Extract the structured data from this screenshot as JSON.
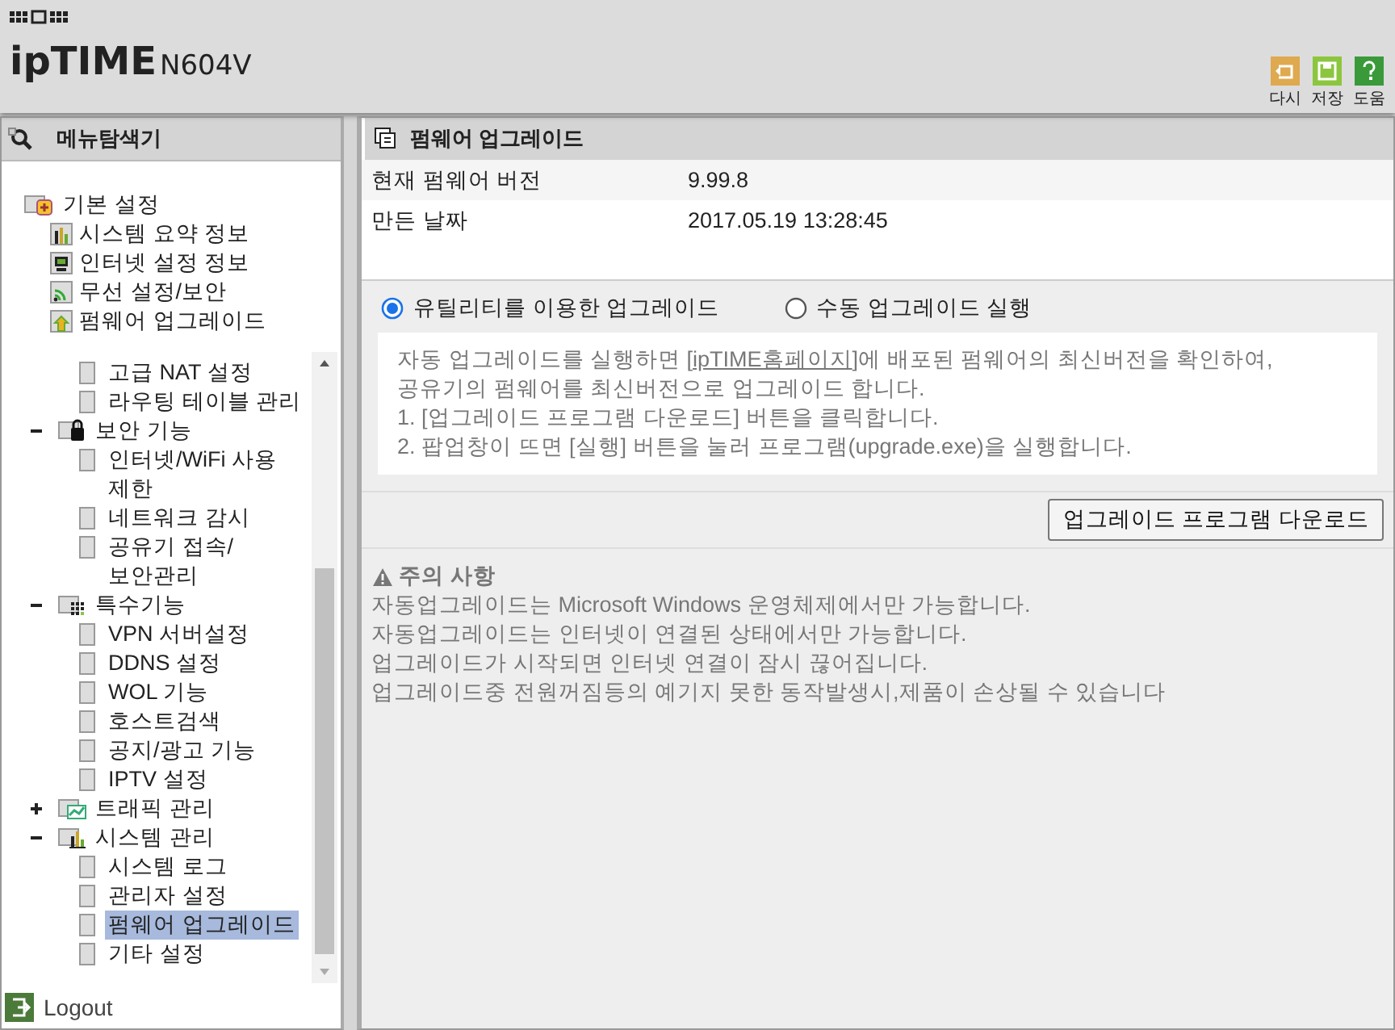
{
  "header": {
    "brand": "ipTIME",
    "model": "N604V",
    "buttons": [
      {
        "label": "다시"
      },
      {
        "label": "저장"
      },
      {
        "label": "도움"
      }
    ]
  },
  "sidebar": {
    "title": "메뉴탐색기",
    "quick_menu": {
      "label": "기본 설정",
      "expanded": true,
      "items": [
        {
          "label": "시스템 요약 정보",
          "selected": false
        },
        {
          "label": "인터넷 설정 정보",
          "selected": false
        },
        {
          "label": "무선 설정/보안",
          "selected": false
        },
        {
          "label": "펌웨어 업그레이드",
          "selected": false
        }
      ]
    },
    "tree": [
      {
        "kind": "page",
        "label": "고급 NAT 설정",
        "selected": false
      },
      {
        "kind": "page",
        "label": "라우팅 테이블 관리",
        "selected": false
      },
      {
        "kind": "folder",
        "label": "보안 기능",
        "expanded": true,
        "children": [
          {
            "kind": "page",
            "label": "인터넷/WiFi 사용 제한",
            "selected": false
          },
          {
            "kind": "page",
            "label": "네트워크 감시",
            "selected": false
          },
          {
            "kind": "page",
            "label": "공유기 접속/보안관리",
            "selected": false
          }
        ]
      },
      {
        "kind": "folder",
        "label": "특수기능",
        "expanded": true,
        "children": [
          {
            "kind": "page",
            "label": "VPN 서버설정",
            "selected": false
          },
          {
            "kind": "page",
            "label": "DDNS 설정",
            "selected": false
          },
          {
            "kind": "page",
            "label": "WOL 기능",
            "selected": false
          },
          {
            "kind": "page",
            "label": "호스트검색",
            "selected": false
          },
          {
            "kind": "page",
            "label": "공지/광고 기능",
            "selected": false
          },
          {
            "kind": "page",
            "label": "IPTV 설정",
            "selected": false
          }
        ]
      },
      {
        "kind": "folder",
        "label": "트래픽 관리",
        "expanded": false
      },
      {
        "kind": "folder",
        "label": "시스템 관리",
        "expanded": true,
        "children": [
          {
            "kind": "page",
            "label": "시스템 로그",
            "selected": false
          },
          {
            "kind": "page",
            "label": "관리자 설정",
            "selected": false
          },
          {
            "kind": "page",
            "label": "펌웨어 업그레이드",
            "selected": true
          },
          {
            "kind": "page",
            "label": "기타 설정",
            "selected": false
          }
        ]
      }
    ],
    "logout": "Logout"
  },
  "main": {
    "title": "펌웨어 업그레이드",
    "info": [
      {
        "label": "현재 펌웨어 버전",
        "value": "9.99.8"
      },
      {
        "label": "만든 날짜",
        "value": "2017.05.19 13:28:45"
      }
    ],
    "modes": [
      {
        "label": "유틸리티를 이용한 업그레이드",
        "selected": true
      },
      {
        "label": "수동 업그레이드 실행",
        "selected": false
      }
    ],
    "description": {
      "before": "자동 업그레이드를 실행하면 [",
      "link": "ipTIME홈페이지",
      "after": "]에 배포된 펌웨어의 최신버전을 확인하여,",
      "lines": [
        "공유기의 펌웨어를 최신버전으로 업그레이드 합니다.",
        "1. [업그레이드 프로그램 다운로드] 버튼을 클릭합니다.",
        "2. 팝업창이 뜨면 [실행] 버튼을 눌러 프로그램(upgrade.exe)을 실행합니다."
      ]
    },
    "download_button": "업그레이드 프로그램 다운로드",
    "caution": {
      "title": "주의 사항",
      "lines": [
        "자동업그레이드는 Microsoft Windows 운영체제에서만 가능합니다.",
        "자동업그레이드는 인터넷이 연결된 상태에서만 가능합니다.",
        "업그레이드가 시작되면 인터넷 연결이 잠시 끊어집니다.",
        "업그레이드중 전원꺼짐등의 예기지 못한 동작발생시,제품이 손상될 수 있습니다"
      ]
    }
  }
}
